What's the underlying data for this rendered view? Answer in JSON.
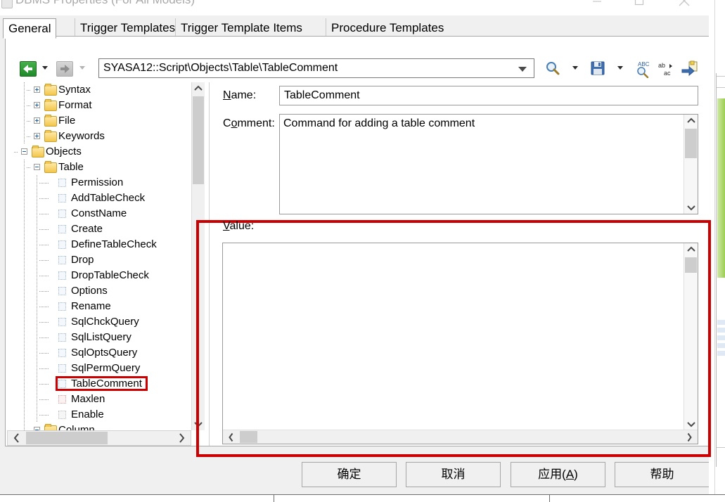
{
  "window": {
    "title": "DBMS Properties (For All Models)",
    "icon": "app-window-icon",
    "minimize_label": "—",
    "maximize_label": "❑",
    "close_label": "✕"
  },
  "tabs": [
    {
      "label": "General",
      "active": true
    },
    {
      "label": "Trigger Templates",
      "active": false
    },
    {
      "label": "Trigger Template Items",
      "active": false
    },
    {
      "label": "Procedure Templates",
      "active": false
    }
  ],
  "toolbar": {
    "back_tooltip": "Back",
    "forward_tooltip": "Forward",
    "path_value": "SYASA12::Script\\Objects\\Table\\TableComment",
    "tools": [
      {
        "name": "find-icon",
        "label": "Find"
      },
      {
        "name": "save-icon",
        "label": "Save"
      },
      {
        "name": "spellcheck-icon",
        "label": "Spelling"
      },
      {
        "name": "replace-icon",
        "label": "Replace"
      },
      {
        "name": "export-icon",
        "label": "Export"
      }
    ]
  },
  "tree": {
    "items": [
      {
        "label": "Syntax",
        "depth": 1,
        "type": "folder",
        "expander": "plus",
        "selected": false
      },
      {
        "label": "Format",
        "depth": 1,
        "type": "folder",
        "expander": "plus",
        "selected": false
      },
      {
        "label": "File",
        "depth": 1,
        "type": "folder",
        "expander": "plus",
        "selected": false
      },
      {
        "label": "Keywords",
        "depth": 1,
        "type": "folder",
        "expander": "plus",
        "selected": false
      },
      {
        "label": "Objects",
        "depth": 0,
        "type": "folder",
        "expander": "minus",
        "selected": false
      },
      {
        "label": "Table",
        "depth": 1,
        "type": "folder",
        "expander": "minus",
        "selected": false
      },
      {
        "label": "Permission",
        "depth": 2,
        "type": "leaf",
        "expander": "none",
        "selected": false
      },
      {
        "label": "AddTableCheck",
        "depth": 2,
        "type": "leaf",
        "expander": "none",
        "selected": false
      },
      {
        "label": "ConstName",
        "depth": 2,
        "type": "leaf",
        "expander": "none",
        "selected": false
      },
      {
        "label": "Create",
        "depth": 2,
        "type": "leaf",
        "expander": "none",
        "selected": false
      },
      {
        "label": "DefineTableCheck",
        "depth": 2,
        "type": "leaf",
        "expander": "none",
        "selected": false
      },
      {
        "label": "Drop",
        "depth": 2,
        "type": "leaf",
        "expander": "none",
        "selected": false
      },
      {
        "label": "DropTableCheck",
        "depth": 2,
        "type": "leaf",
        "expander": "none",
        "selected": false
      },
      {
        "label": "Options",
        "depth": 2,
        "type": "leaf",
        "expander": "none",
        "selected": false
      },
      {
        "label": "Rename",
        "depth": 2,
        "type": "leaf",
        "expander": "none",
        "selected": false
      },
      {
        "label": "SqlChckQuery",
        "depth": 2,
        "type": "leaf",
        "expander": "none",
        "selected": false
      },
      {
        "label": "SqlListQuery",
        "depth": 2,
        "type": "leaf",
        "expander": "none",
        "selected": false
      },
      {
        "label": "SqlOptsQuery",
        "depth": 2,
        "type": "leaf",
        "expander": "none",
        "selected": false
      },
      {
        "label": "SqlPermQuery",
        "depth": 2,
        "type": "leaf",
        "expander": "none",
        "selected": false
      },
      {
        "label": "TableComment",
        "depth": 2,
        "type": "leaf",
        "expander": "none",
        "selected": true
      },
      {
        "label": "Maxlen",
        "depth": 2,
        "type": "leaf2",
        "expander": "none",
        "selected": false
      },
      {
        "label": "Enable",
        "depth": 2,
        "type": "leaf3",
        "expander": "none",
        "selected": false
      },
      {
        "label": "Column",
        "depth": 1,
        "type": "folder",
        "expander": "minus",
        "selected": false
      }
    ]
  },
  "form": {
    "name_label": "Name:",
    "name_value": "TableComment",
    "comment_label": "Comment:",
    "comment_value": "Command for adding a table comment",
    "value_label": "Value:",
    "value_value": ""
  },
  "buttons": {
    "ok": "确定",
    "cancel": "取消",
    "apply_prefix": "应用(",
    "apply_key": "A",
    "apply_suffix": ")",
    "help": "帮助"
  },
  "annotation": {
    "highlight_color": "#cc0000",
    "highlight_targets": [
      "value-field-group",
      "tree-item-tablecomment"
    ]
  }
}
